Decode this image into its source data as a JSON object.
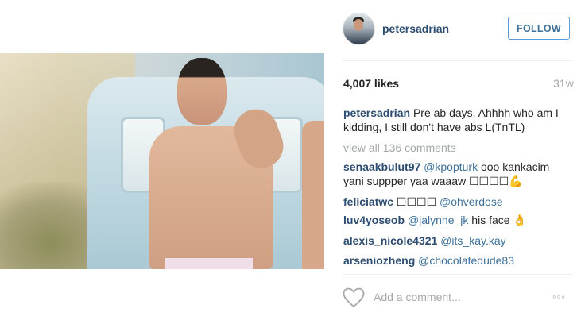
{
  "post": {
    "photo_alt": "",
    "header": {
      "username": "petersadrian",
      "follow_label": "FOLLOW"
    },
    "likes": "4,007 likes",
    "age": "31w",
    "caption": {
      "username": "petersadrian",
      "text": "Pre ab days. Ahhhh who am I kidding, I still don't have abs L(TnTL)"
    },
    "view_all": "view all 136 comments",
    "comments": [
      {
        "username": "senaakbulut97",
        "mention": "@kpopturk",
        "text": " ooo kankacim yani suppper yaa waaaw ☐☐☐☐💪"
      },
      {
        "username": "feliciatwc",
        "mention": "@ohverdose",
        "text": "☐☐☐☐ "
      },
      {
        "username": "luv4yoseob",
        "mention": "@jalynne_jk",
        "text": " his face 👌"
      },
      {
        "username": "alexis_nicole4321",
        "mention": "@its_kay.kay",
        "text": ""
      },
      {
        "username": "arseniozheng",
        "mention": "@chocolatedude83",
        "text": ""
      }
    ],
    "add_comment_placeholder": "Add a comment...",
    "more_label": "◦◦◦"
  },
  "icons": {
    "heart": "heart-outline-icon",
    "more": "more-options-icon"
  },
  "colors": {
    "username": "#2d4c71",
    "mention": "#3f729b",
    "muted": "#a5a7aa",
    "follow_border": "#5b9bd5"
  }
}
